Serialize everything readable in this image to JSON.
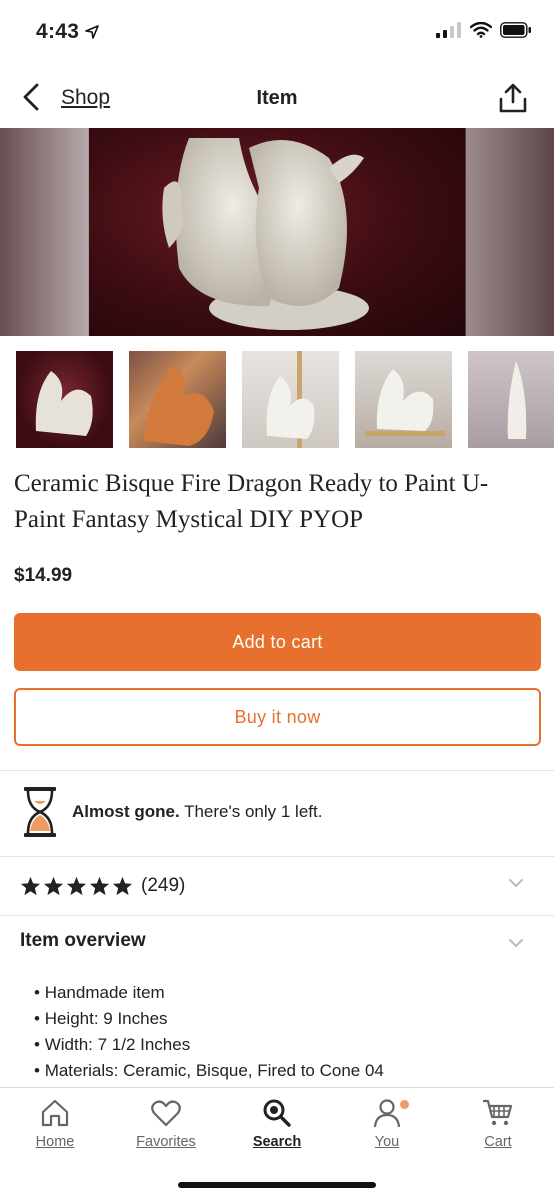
{
  "status_bar": {
    "time": "4:43"
  },
  "nav": {
    "back_label": "Shop",
    "title": "Item"
  },
  "product": {
    "title": "Ceramic Bisque Fire Dragon Ready to Paint U-Paint Fantasy Mystical DIY PYOP",
    "price": "$14.99",
    "thumbnail_count": 5
  },
  "actions": {
    "add_to_cart": "Add to cart",
    "buy_now": "Buy it now"
  },
  "stock": {
    "strong": "Almost gone.",
    "rest": " There's only 1 left."
  },
  "reviews": {
    "rating": 5,
    "count": "(249)"
  },
  "overview": {
    "title": "Item overview",
    "items": [
      "Handmade item",
      "Height: 9 Inches",
      "Width: 7 1/2 Inches",
      "Materials: Ceramic, Bisque, Fired to Cone 04"
    ]
  },
  "tabs": [
    {
      "label": "Home",
      "icon": "home-icon"
    },
    {
      "label": "Favorites",
      "icon": "heart-icon"
    },
    {
      "label": "Search",
      "icon": "search-icon"
    },
    {
      "label": "You",
      "icon": "user-icon"
    },
    {
      "label": "Cart",
      "icon": "cart-icon"
    }
  ],
  "colors": {
    "accent": "#e8702f",
    "notification_dot": "#f09a64"
  }
}
